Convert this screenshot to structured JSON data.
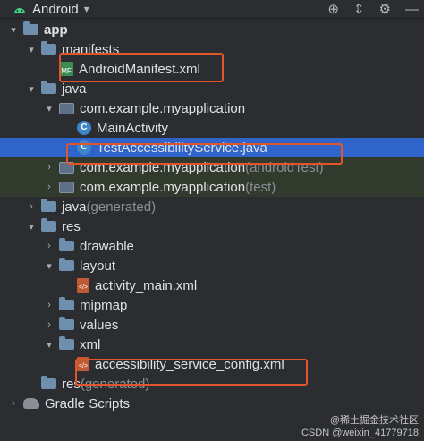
{
  "toolbar": {
    "title": "Android",
    "dropdown_icon": "▾",
    "icons": [
      "crosshair-icon",
      "collapse-icon",
      "gear-icon",
      "minus-icon"
    ]
  },
  "tree": [
    {
      "label": "app",
      "suffix": "",
      "level": 0,
      "chevron": "▾",
      "icon": "folder",
      "bold": true
    },
    {
      "label": "manifests",
      "suffix": "",
      "level": 1,
      "chevron": "▾",
      "icon": "folder"
    },
    {
      "label": "AndroidManifest.xml",
      "suffix": "",
      "level": 2,
      "chevron": "",
      "icon": "mf"
    },
    {
      "label": "java",
      "suffix": "",
      "level": 1,
      "chevron": "▾",
      "icon": "folder"
    },
    {
      "label": "com.example.myapplication",
      "suffix": "",
      "level": 2,
      "chevron": "▾",
      "icon": "pkg"
    },
    {
      "label": "MainActivity",
      "suffix": "",
      "level": 3,
      "chevron": "",
      "icon": "cls"
    },
    {
      "label": "TestAccessibilityService.java",
      "suffix": "",
      "level": 3,
      "chevron": "",
      "icon": "cls",
      "selected": true
    },
    {
      "label": "com.example.myapplication",
      "suffix": " (androidTest)",
      "level": 2,
      "chevron": "›",
      "icon": "pkg",
      "ctx": true
    },
    {
      "label": "com.example.myapplication",
      "suffix": " (test)",
      "level": 2,
      "chevron": "›",
      "icon": "pkg",
      "ctx": true
    },
    {
      "label": "java",
      "suffix": " (generated)",
      "level": 1,
      "chevron": "›",
      "icon": "folder"
    },
    {
      "label": "res",
      "suffix": "",
      "level": 1,
      "chevron": "▾",
      "icon": "folder"
    },
    {
      "label": "drawable",
      "suffix": "",
      "level": 2,
      "chevron": "›",
      "icon": "folder"
    },
    {
      "label": "layout",
      "suffix": "",
      "level": 2,
      "chevron": "▾",
      "icon": "folder"
    },
    {
      "label": "activity_main.xml",
      "suffix": "",
      "level": 3,
      "chevron": "",
      "icon": "xml"
    },
    {
      "label": "mipmap",
      "suffix": "",
      "level": 2,
      "chevron": "›",
      "icon": "folder"
    },
    {
      "label": "values",
      "suffix": "",
      "level": 2,
      "chevron": "›",
      "icon": "folder"
    },
    {
      "label": "xml",
      "suffix": "",
      "level": 2,
      "chevron": "▾",
      "icon": "folder"
    },
    {
      "label": "accessibility_service_config.xml",
      "suffix": "",
      "level": 3,
      "chevron": "",
      "icon": "xml"
    },
    {
      "label": "res",
      "suffix": " (generated)",
      "level": 1,
      "chevron": "",
      "icon": "folder"
    },
    {
      "label": "Gradle Scripts",
      "suffix": "",
      "level": 0,
      "chevron": "›",
      "icon": "gradle"
    }
  ],
  "icon_letters": {
    "cls": "C",
    "xml": "</>",
    "mf": "MF"
  },
  "watermark": {
    "line1": "@稀土掘金技术社区",
    "line2": "CSDN @weixin_41779718"
  },
  "colors": {
    "background": "#2b2d30",
    "selection": "#2f65ca",
    "highlight_box": "#e2552c"
  }
}
